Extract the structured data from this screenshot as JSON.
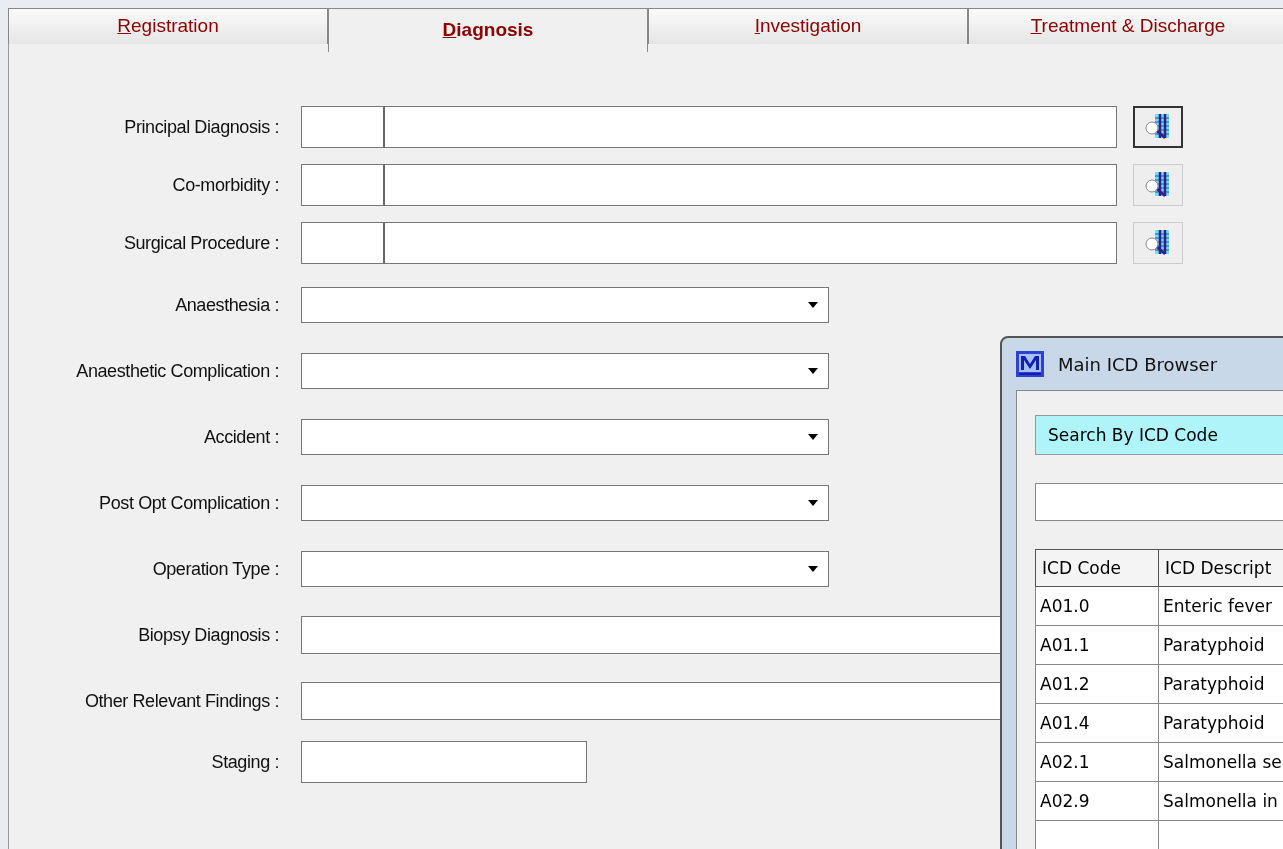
{
  "tabs": [
    {
      "label": "Registration",
      "selected": false
    },
    {
      "label": "Diagnosis",
      "selected": true
    },
    {
      "label": "Investigation",
      "selected": false
    },
    {
      "label": "Treatment & Discharge",
      "selected": false
    }
  ],
  "form": [
    {
      "label": "Principal Diagnosis :",
      "kind": "code"
    },
    {
      "label": "Co-morbidity :",
      "kind": "code"
    },
    {
      "label": "Surgical Procedure :",
      "kind": "code"
    },
    {
      "label": "Anaesthesia :",
      "kind": "select"
    },
    {
      "label": "Anaesthetic Complication :",
      "kind": "select"
    },
    {
      "label": "Accident :",
      "kind": "select"
    },
    {
      "label": "Post Opt Complication :",
      "kind": "select"
    },
    {
      "label": "Operation Type :",
      "kind": "select"
    },
    {
      "label": "Biopsy Diagnosis :",
      "kind": "text"
    },
    {
      "label": "Other Relevant Findings :",
      "kind": "text"
    },
    {
      "label": "Staging :",
      "kind": "short"
    }
  ],
  "dialog": {
    "title": "Main ICD Browser",
    "search_mode": "Search By ICD Code",
    "table": {
      "columns": [
        "ICD Code",
        "ICD Descript"
      ],
      "rows": [
        [
          "A01.0",
          "Enteric fever"
        ],
        [
          "A01.1",
          "Paratyphoid"
        ],
        [
          "A01.2",
          "Paratyphoid"
        ],
        [
          "A01.4",
          "Paratyphoid"
        ],
        [
          "A02.1",
          "Salmonella se"
        ],
        [
          "A02.9",
          "Salmonella in"
        ]
      ]
    }
  }
}
